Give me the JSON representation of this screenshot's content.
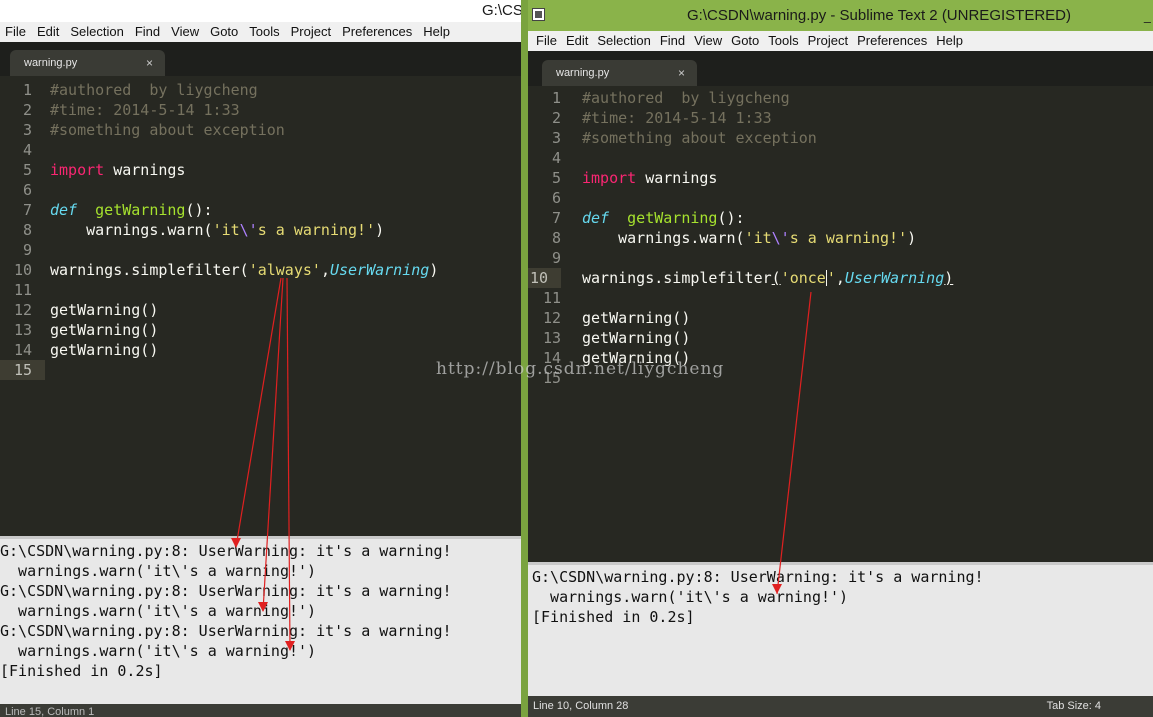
{
  "left_window": {
    "title": "G:\\CS",
    "menu": [
      "File",
      "Edit",
      "Selection",
      "Find",
      "View",
      "Goto",
      "Tools",
      "Project",
      "Preferences",
      "Help"
    ],
    "tab": {
      "label": "warning.py",
      "close": "×"
    },
    "line_numbers": [
      "1",
      "2",
      "3",
      "4",
      "5",
      "6",
      "7",
      "8",
      "9",
      "10",
      "11",
      "12",
      "13",
      "14",
      "15"
    ],
    "code": {
      "l1": "#authored  by liygcheng",
      "l2": "#time: 2014-5-14 1:33",
      "l3": "#something about exception",
      "l5_kw": "import",
      "l5_rest": " warnings",
      "l7_kw": "def",
      "l7_fn": "getWarning",
      "l7_rest": "():",
      "l8_a": "    warnings.warn(",
      "l8_s1": "'it",
      "l8_esc": "\\'",
      "l8_s2": "s a warning!'",
      "l8_b": ")",
      "l10_a": "warnings.simplefilter(",
      "l10_str": "'always'",
      "l10_comma": ",",
      "l10_cls": "UserWarning",
      "l10_b": ")",
      "l12": "getWarning()",
      "l13": "getWarning()",
      "l14": "getWarning()"
    },
    "output": [
      "G:\\CSDN\\warning.py:8: UserWarning: it's a warning!",
      "  warnings.warn('it\\'s a warning!')",
      "G:\\CSDN\\warning.py:8: UserWarning: it's a warning!",
      "  warnings.warn('it\\'s a warning!')",
      "G:\\CSDN\\warning.py:8: UserWarning: it's a warning!",
      "  warnings.warn('it\\'s a warning!')",
      "[Finished in 0.2s]"
    ],
    "status": "Line 15, Column 1"
  },
  "right_window": {
    "title": "G:\\CSDN\\warning.py - Sublime Text 2 (UNREGISTERED)",
    "menu": [
      "File",
      "Edit",
      "Selection",
      "Find",
      "View",
      "Goto",
      "Tools",
      "Project",
      "Preferences",
      "Help"
    ],
    "tab": {
      "label": "warning.py",
      "close": "×"
    },
    "line_numbers": [
      "1",
      "2",
      "3",
      "4",
      "5",
      "6",
      "7",
      "8",
      "9",
      "10",
      "11",
      "12",
      "13",
      "14",
      "15"
    ],
    "code": {
      "l1": "#authored  by liygcheng",
      "l2": "#time: 2014-5-14 1:33",
      "l3": "#something about exception",
      "l5_kw": "import",
      "l5_rest": " warnings",
      "l7_kw": "def",
      "l7_fn": "getWarning",
      "l7_rest": "():",
      "l8_a": "    warnings.warn(",
      "l8_s1": "'it",
      "l8_esc": "\\'",
      "l8_s2": "s a warning!'",
      "l8_b": ")",
      "l10_a": "warnings.simplefilter",
      "l10_open": "(",
      "l10_str1": "'once",
      "l10_str2": "'",
      "l10_comma": ",",
      "l10_cls": "UserWarning",
      "l10_b": ")",
      "l12": "getWarning()",
      "l13": "getWarning()",
      "l14": "getWarning()"
    },
    "output": [
      "G:\\CSDN\\warning.py:8: UserWarning: it's a warning!",
      "  warnings.warn('it\\'s a warning!')",
      "[Finished in 0.2s]"
    ],
    "status_left": "Line 10, Column 28",
    "status_right": "Tab Size: 4"
  },
  "watermark": "http://blog.csdn.net/liygcheng",
  "annotation_color": "#e02020"
}
